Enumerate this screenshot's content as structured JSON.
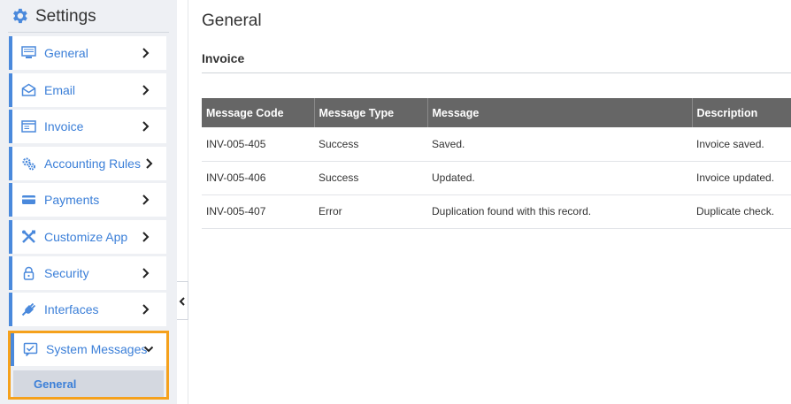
{
  "sidebar": {
    "title": "Settings",
    "items": [
      {
        "label": "General",
        "icon": "monitor-icon"
      },
      {
        "label": "Email",
        "icon": "envelope-icon"
      },
      {
        "label": "Invoice",
        "icon": "invoice-icon"
      },
      {
        "label": "Accounting Rules",
        "icon": "gears-icon"
      },
      {
        "label": "Payments",
        "icon": "credit-card-icon"
      },
      {
        "label": "Customize App",
        "icon": "tools-icon"
      },
      {
        "label": "Security",
        "icon": "lock-icon"
      },
      {
        "label": "Interfaces",
        "icon": "plug-icon"
      }
    ],
    "expanded_item": {
      "label": "System Messages",
      "icon": "message-check-icon",
      "sub_items": [
        {
          "label": "General",
          "selected": true
        }
      ]
    }
  },
  "main": {
    "page_title": "General",
    "section_title": "Invoice",
    "table": {
      "columns": [
        "Message Code",
        "Message Type",
        "Message",
        "Description"
      ],
      "rows": [
        [
          "INV-005-405",
          "Success",
          "Saved.",
          "Invoice saved."
        ],
        [
          "INV-005-406",
          "Success",
          "Updated.",
          "Invoice updated."
        ],
        [
          "INV-005-407",
          "Error",
          "Duplication found with this record.",
          "Duplicate check."
        ]
      ]
    }
  },
  "colors": {
    "accent": "#4a89dc",
    "highlight_border": "#f5a11c",
    "table_header": "#666666",
    "sidebar_bg": "#eef0f4"
  }
}
